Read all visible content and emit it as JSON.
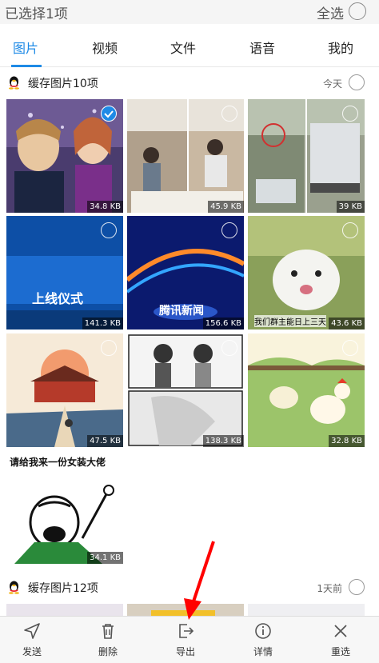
{
  "topbar": {
    "title": "已选择1项",
    "select_all": "全选"
  },
  "tabs": [
    {
      "label": "图片",
      "active": true
    },
    {
      "label": "视频"
    },
    {
      "label": "文件"
    },
    {
      "label": "语音"
    },
    {
      "label": "我的"
    }
  ],
  "sections": [
    {
      "title": "缓存图片10项",
      "time": "今天"
    },
    {
      "title": "缓存图片12项",
      "time": "1天前"
    }
  ],
  "thumbs": [
    {
      "size": "34.8 KB",
      "selected": true
    },
    {
      "size": "45.9 KB"
    },
    {
      "size": "39 KB"
    },
    {
      "size": "141.3 KB",
      "text": "上线仪式"
    },
    {
      "size": "156.6 KB",
      "text": "腾讯新闻"
    },
    {
      "size": "43.6 KB",
      "text": "我们群主能日上三天"
    },
    {
      "size": "47.5 KB"
    },
    {
      "size": "138.3 KB"
    },
    {
      "size": "32.8 KB"
    },
    {
      "size": "34.1 KB",
      "text": "请给我来一份女装大佬"
    }
  ],
  "bottom_actions": [
    {
      "label": "发送",
      "icon": "send-icon"
    },
    {
      "label": "删除",
      "icon": "trash-icon"
    },
    {
      "label": "导出",
      "icon": "export-icon"
    },
    {
      "label": "详情",
      "icon": "info-icon"
    },
    {
      "label": "重选",
      "icon": "close-icon"
    }
  ],
  "colors": {
    "accent": "#1e8ae6",
    "annotation_arrow": "#ff0000"
  }
}
